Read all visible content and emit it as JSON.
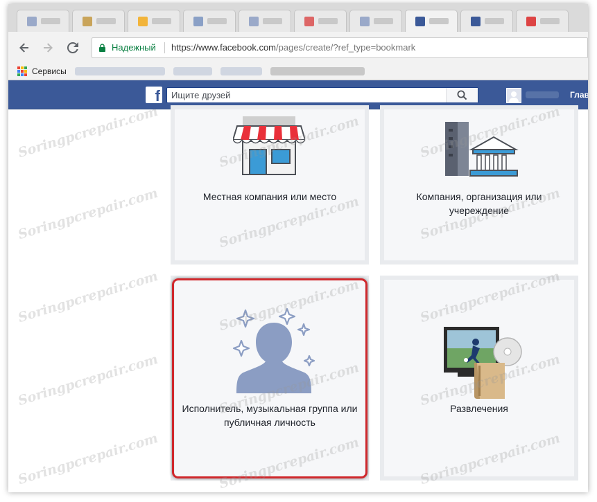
{
  "browser": {
    "address": {
      "security_label": "Надежный",
      "url_host": "https://www.facebook.com",
      "url_path": "/pages/create/?ref_type=bookmark"
    },
    "nav": {
      "back_icon": "arrow-left-icon",
      "forward_icon": "arrow-right-icon",
      "reload_icon": "reload-icon"
    },
    "bookmarks": {
      "apps_label": "Сервисы"
    }
  },
  "facebook": {
    "logo_letter": "f",
    "search": {
      "placeholder": "Ищите друзей"
    },
    "home_label": "Глав",
    "brand_color": "#3b5998"
  },
  "categories": [
    {
      "label": "Местная компания или место",
      "icon": "storefront-icon"
    },
    {
      "label": "Компания, организация или учереждение",
      "icon": "company-buildings-icon"
    },
    {
      "label": "Исполнитель, музыкальная группа или публичная личность",
      "icon": "public-figure-icon",
      "highlighted": true
    },
    {
      "label": "Развлечения",
      "icon": "entertainment-icon"
    }
  ],
  "watermark": "Soringpcrepair.com",
  "highlight_color": "#d0282c"
}
